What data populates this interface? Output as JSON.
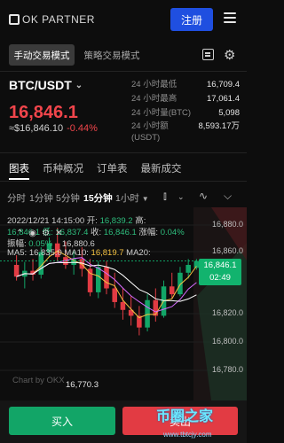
{
  "header": {
    "logo_text": "OK PARTNER",
    "register_label": "注册"
  },
  "modes": {
    "manual": "手动交易模式",
    "strategy": "策略交易模式"
  },
  "market": {
    "pair": "BTC/USDT",
    "last_price": "16,846.1",
    "fiat_price": "≈$16,846.10",
    "change": "-0.44%",
    "stats": [
      {
        "label": "24 小时最低",
        "value": "16,709.4"
      },
      {
        "label": "24 小时最高",
        "value": "17,061.4"
      },
      {
        "label": "24 小时量(BTC)",
        "value": "5,098"
      },
      {
        "label": "24 小时额(USDT)",
        "value": "8,593.17万"
      }
    ]
  },
  "tabs": [
    "图表",
    "币种概况",
    "订单表",
    "最新成交"
  ],
  "timeframes": [
    "分时",
    "1分钟",
    "5分钟",
    "15分钟",
    "1小时"
  ],
  "chart_info": {
    "line1": "2022/12/21 14:15:00  开: ",
    "open": "16,839.2",
    "high_label": "  高:",
    "low_line_prefix": "16,846.1  低: ",
    "low": "16,837.4",
    "close_label": "  收: ",
    "close": "16,846.1",
    "change_label": "  涨幅: ",
    "change_pct": "0.04%",
    "amp_label": "振幅: ",
    "amp": "0.05%",
    "ma5_label": "MA5: ",
    "ma5": "16,835.0",
    "ma10_label": "  MA10: ",
    "ma10": "16,819.7",
    "ma20_label": "  MA20:",
    "overlap_price": "16,880.6"
  },
  "chart_data": {
    "type": "candlestick",
    "y_ticks": [
      "16,880.0",
      "16,860.0",
      "16,820.0",
      "16,800.0",
      "16,780.0"
    ],
    "ylim": [
      16765,
      16890
    ],
    "current_price": "16,846.1",
    "countdown": "02:49",
    "low_marker": "16,770.3",
    "candles": [
      {
        "o": 16842,
        "h": 16852,
        "l": 16826,
        "c": 16830
      },
      {
        "o": 16830,
        "h": 16845,
        "l": 16818,
        "c": 16836
      },
      {
        "o": 16836,
        "h": 16848,
        "l": 16826,
        "c": 16832
      },
      {
        "o": 16832,
        "h": 16860,
        "l": 16828,
        "c": 16855
      },
      {
        "o": 16855,
        "h": 16870,
        "l": 16850,
        "c": 16864
      },
      {
        "o": 16864,
        "h": 16880,
        "l": 16846,
        "c": 16850
      },
      {
        "o": 16850,
        "h": 16866,
        "l": 16838,
        "c": 16842
      },
      {
        "o": 16842,
        "h": 16856,
        "l": 16832,
        "c": 16848
      },
      {
        "o": 16848,
        "h": 16860,
        "l": 16830,
        "c": 16838
      },
      {
        "o": 16838,
        "h": 16848,
        "l": 16810,
        "c": 16814
      },
      {
        "o": 16814,
        "h": 16846,
        "l": 16808,
        "c": 16840
      },
      {
        "o": 16840,
        "h": 16846,
        "l": 16812,
        "c": 16818
      },
      {
        "o": 16818,
        "h": 16834,
        "l": 16798,
        "c": 16804
      },
      {
        "o": 16804,
        "h": 16818,
        "l": 16786,
        "c": 16796
      },
      {
        "o": 16796,
        "h": 16810,
        "l": 16780,
        "c": 16790
      },
      {
        "o": 16790,
        "h": 16800,
        "l": 16770,
        "c": 16778
      },
      {
        "o": 16778,
        "h": 16812,
        "l": 16774,
        "c": 16806
      },
      {
        "o": 16806,
        "h": 16818,
        "l": 16784,
        "c": 16790
      },
      {
        "o": 16790,
        "h": 16826,
        "l": 16788,
        "c": 16820
      },
      {
        "o": 16820,
        "h": 16834,
        "l": 16808,
        "c": 16812
      },
      {
        "o": 16812,
        "h": 16840,
        "l": 16810,
        "c": 16834
      },
      {
        "o": 16834,
        "h": 16848,
        "l": 16828,
        "c": 16842
      },
      {
        "o": 16839,
        "h": 16848,
        "l": 16837,
        "c": 16846
      }
    ],
    "ma_colors": {
      "ma5": "#f5c242",
      "ma10": "#d66bff",
      "ma20": "#ffffff"
    },
    "watermark": "Chart by OKX"
  },
  "actions": {
    "buy_label": "买入",
    "sell_label": "卖出"
  },
  "overlay": {
    "brand": "币圈之家",
    "url": "www.tbtcjy.com"
  },
  "colors": {
    "up": "#12a567",
    "down": "#e23b43",
    "accent": "#1f4fe0"
  }
}
